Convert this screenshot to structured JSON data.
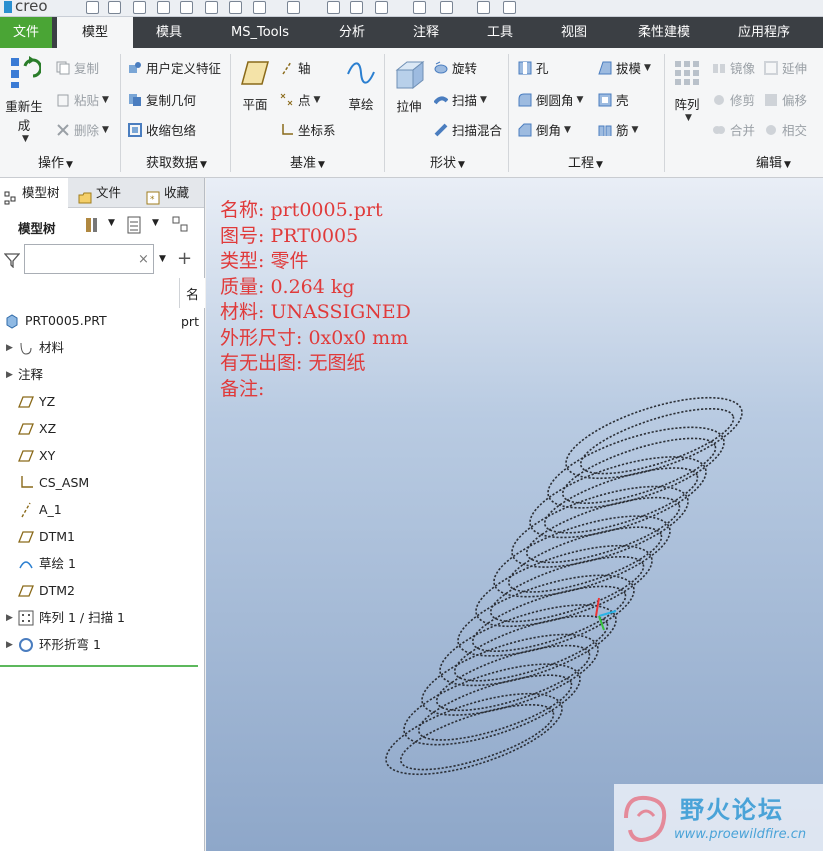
{
  "app": {
    "logo": "creo"
  },
  "tabs": [
    {
      "label": "文件"
    },
    {
      "label": "模型"
    },
    {
      "label": "模具"
    },
    {
      "label": "MS_Tools"
    },
    {
      "label": "分析"
    },
    {
      "label": "注释"
    },
    {
      "label": "工具"
    },
    {
      "label": "视图"
    },
    {
      "label": "柔性建模"
    },
    {
      "label": "应用程序"
    }
  ],
  "ribbon": {
    "operations": {
      "regen": "重新生成",
      "copy": "复制",
      "paste": "粘贴",
      "delete": "删除",
      "group": "操作"
    },
    "getdata": {
      "udf": "用户定义特征",
      "copygeom": "复制几何",
      "shrinkwrap": "收缩包络",
      "group": "获取数据"
    },
    "datum": {
      "plane": "平面",
      "axis": "轴",
      "point": "点",
      "csys": "坐标系",
      "sketch": "草绘",
      "group": "基准"
    },
    "shapes": {
      "extrude": "拉伸",
      "revolve": "旋转",
      "sweep": "扫描",
      "blend": "扫描混合",
      "group": "形状"
    },
    "engineering": {
      "hole": "孔",
      "round": "倒圆角",
      "chamfer": "倒角",
      "draft": "拔模",
      "shell": "壳",
      "rib": "筋",
      "group": "工程"
    },
    "editing": {
      "pattern": "阵列",
      "mirror": "镜像",
      "extend": "延伸",
      "trim": "修剪",
      "offset": "偏移",
      "merge": "合并",
      "intersect": "相交",
      "group": "编辑"
    }
  },
  "left_panel": {
    "tabs": [
      {
        "label": "模型树"
      },
      {
        "label": "文件"
      },
      {
        "label": "收藏"
      }
    ],
    "toolbar_label": "模型树",
    "filter_placeholder": "",
    "column_header": "名",
    "root": {
      "label": "PRT0005.PRT",
      "col": "prt"
    },
    "items": [
      {
        "label": "材料"
      },
      {
        "label": "注释"
      },
      {
        "label": "YZ"
      },
      {
        "label": "XZ"
      },
      {
        "label": "XY"
      },
      {
        "label": "CS_ASM"
      },
      {
        "label": "A_1"
      },
      {
        "label": "DTM1"
      },
      {
        "label": "草绘 1"
      },
      {
        "label": "DTM2"
      },
      {
        "label": "阵列 1 / 扫描 1"
      },
      {
        "label": "环形折弯 1"
      }
    ]
  },
  "viewport": {
    "info": [
      "名称: prt0005.prt",
      "图号: PRT0005",
      "类型: 零件",
      "质量: 0.264 kg",
      "材料: UNASSIGNED",
      "外形尺寸: 0x0x0 mm",
      "有无出图: 无图纸",
      "备注:"
    ],
    "watermark_title": "野火论坛",
    "watermark_url": "www.proewildfire.cn"
  },
  "colors": {
    "file_tab": "#4aa535",
    "tabbar": "#3b3f44",
    "info_text": "#e03a3a"
  }
}
